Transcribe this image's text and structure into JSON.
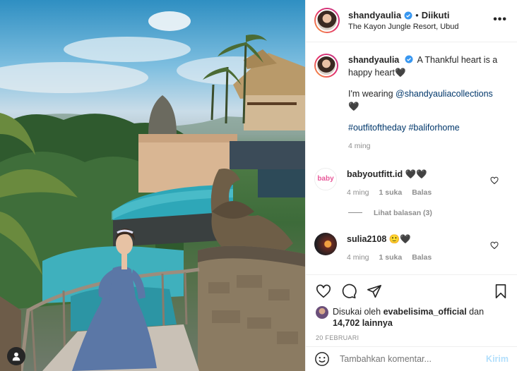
{
  "post": {
    "author": "shandyaulia",
    "follow_separator": "•",
    "follow_status": "Diikuti",
    "location": "The Kayon Jungle Resort, Ubud",
    "more_icon": "more-horizontal-icon",
    "more_label": "•••"
  },
  "caption": {
    "username": "shandyaulia",
    "text": "A Thankful heart is a happy heart🖤",
    "wearing_prefix": "I'm wearing ",
    "wearing_link": "@shandyauliacollections",
    "wearing_suffix": " 🖤",
    "hashtags": "#outfitoftheday #baliforhome",
    "time": "4 ming"
  },
  "comments": [
    {
      "username": "babyoutfitt.id",
      "text": "🖤🖤",
      "time": "4 ming",
      "likes": "1 suka",
      "reply": "Balas",
      "avatar_text": "baby"
    },
    {
      "username": "sulia2108",
      "text": "🙂🖤",
      "time": "4 ming",
      "likes": "1 suka",
      "reply": "Balas"
    }
  ],
  "view_replies": "Lihat balasan (3)",
  "likes": {
    "prefix": "Disukai oleh ",
    "user": "evabelisima_official",
    "mid": " dan ",
    "count": "14,702 lainnya"
  },
  "date": "20 FEBRUARI",
  "add_comment": {
    "placeholder": "Tambahkan komentar...",
    "post_label": "Kirim"
  },
  "colors": {
    "verified": "#3897f0",
    "link": "#00376b",
    "muted": "#8e8e8e",
    "post_disabled": "#b2dffc"
  }
}
